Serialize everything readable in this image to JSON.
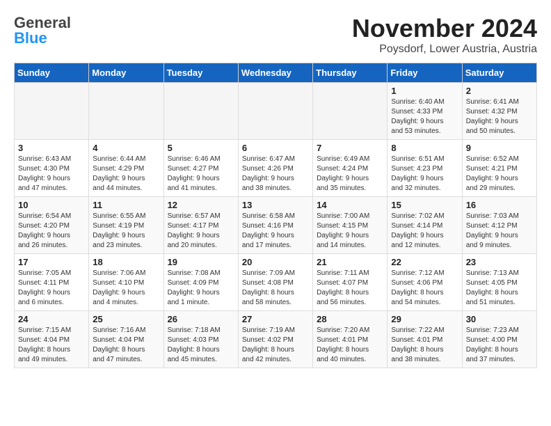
{
  "header": {
    "logo_line1": "General",
    "logo_line2": "Blue",
    "title": "November 2024",
    "subtitle": "Poysdorf, Lower Austria, Austria"
  },
  "calendar": {
    "days_of_week": [
      "Sunday",
      "Monday",
      "Tuesday",
      "Wednesday",
      "Thursday",
      "Friday",
      "Saturday"
    ],
    "weeks": [
      [
        {
          "day": "",
          "info": ""
        },
        {
          "day": "",
          "info": ""
        },
        {
          "day": "",
          "info": ""
        },
        {
          "day": "",
          "info": ""
        },
        {
          "day": "",
          "info": ""
        },
        {
          "day": "1",
          "info": "Sunrise: 6:40 AM\nSunset: 4:33 PM\nDaylight: 9 hours\nand 53 minutes."
        },
        {
          "day": "2",
          "info": "Sunrise: 6:41 AM\nSunset: 4:32 PM\nDaylight: 9 hours\nand 50 minutes."
        }
      ],
      [
        {
          "day": "3",
          "info": "Sunrise: 6:43 AM\nSunset: 4:30 PM\nDaylight: 9 hours\nand 47 minutes."
        },
        {
          "day": "4",
          "info": "Sunrise: 6:44 AM\nSunset: 4:29 PM\nDaylight: 9 hours\nand 44 minutes."
        },
        {
          "day": "5",
          "info": "Sunrise: 6:46 AM\nSunset: 4:27 PM\nDaylight: 9 hours\nand 41 minutes."
        },
        {
          "day": "6",
          "info": "Sunrise: 6:47 AM\nSunset: 4:26 PM\nDaylight: 9 hours\nand 38 minutes."
        },
        {
          "day": "7",
          "info": "Sunrise: 6:49 AM\nSunset: 4:24 PM\nDaylight: 9 hours\nand 35 minutes."
        },
        {
          "day": "8",
          "info": "Sunrise: 6:51 AM\nSunset: 4:23 PM\nDaylight: 9 hours\nand 32 minutes."
        },
        {
          "day": "9",
          "info": "Sunrise: 6:52 AM\nSunset: 4:21 PM\nDaylight: 9 hours\nand 29 minutes."
        }
      ],
      [
        {
          "day": "10",
          "info": "Sunrise: 6:54 AM\nSunset: 4:20 PM\nDaylight: 9 hours\nand 26 minutes."
        },
        {
          "day": "11",
          "info": "Sunrise: 6:55 AM\nSunset: 4:19 PM\nDaylight: 9 hours\nand 23 minutes."
        },
        {
          "day": "12",
          "info": "Sunrise: 6:57 AM\nSunset: 4:17 PM\nDaylight: 9 hours\nand 20 minutes."
        },
        {
          "day": "13",
          "info": "Sunrise: 6:58 AM\nSunset: 4:16 PM\nDaylight: 9 hours\nand 17 minutes."
        },
        {
          "day": "14",
          "info": "Sunrise: 7:00 AM\nSunset: 4:15 PM\nDaylight: 9 hours\nand 14 minutes."
        },
        {
          "day": "15",
          "info": "Sunrise: 7:02 AM\nSunset: 4:14 PM\nDaylight: 9 hours\nand 12 minutes."
        },
        {
          "day": "16",
          "info": "Sunrise: 7:03 AM\nSunset: 4:12 PM\nDaylight: 9 hours\nand 9 minutes."
        }
      ],
      [
        {
          "day": "17",
          "info": "Sunrise: 7:05 AM\nSunset: 4:11 PM\nDaylight: 9 hours\nand 6 minutes."
        },
        {
          "day": "18",
          "info": "Sunrise: 7:06 AM\nSunset: 4:10 PM\nDaylight: 9 hours\nand 4 minutes."
        },
        {
          "day": "19",
          "info": "Sunrise: 7:08 AM\nSunset: 4:09 PM\nDaylight: 9 hours\nand 1 minute."
        },
        {
          "day": "20",
          "info": "Sunrise: 7:09 AM\nSunset: 4:08 PM\nDaylight: 8 hours\nand 58 minutes."
        },
        {
          "day": "21",
          "info": "Sunrise: 7:11 AM\nSunset: 4:07 PM\nDaylight: 8 hours\nand 56 minutes."
        },
        {
          "day": "22",
          "info": "Sunrise: 7:12 AM\nSunset: 4:06 PM\nDaylight: 8 hours\nand 54 minutes."
        },
        {
          "day": "23",
          "info": "Sunrise: 7:13 AM\nSunset: 4:05 PM\nDaylight: 8 hours\nand 51 minutes."
        }
      ],
      [
        {
          "day": "24",
          "info": "Sunrise: 7:15 AM\nSunset: 4:04 PM\nDaylight: 8 hours\nand 49 minutes."
        },
        {
          "day": "25",
          "info": "Sunrise: 7:16 AM\nSunset: 4:04 PM\nDaylight: 8 hours\nand 47 minutes."
        },
        {
          "day": "26",
          "info": "Sunrise: 7:18 AM\nSunset: 4:03 PM\nDaylight: 8 hours\nand 45 minutes."
        },
        {
          "day": "27",
          "info": "Sunrise: 7:19 AM\nSunset: 4:02 PM\nDaylight: 8 hours\nand 42 minutes."
        },
        {
          "day": "28",
          "info": "Sunrise: 7:20 AM\nSunset: 4:01 PM\nDaylight: 8 hours\nand 40 minutes."
        },
        {
          "day": "29",
          "info": "Sunrise: 7:22 AM\nSunset: 4:01 PM\nDaylight: 8 hours\nand 38 minutes."
        },
        {
          "day": "30",
          "info": "Sunrise: 7:23 AM\nSunset: 4:00 PM\nDaylight: 8 hours\nand 37 minutes."
        }
      ]
    ]
  }
}
